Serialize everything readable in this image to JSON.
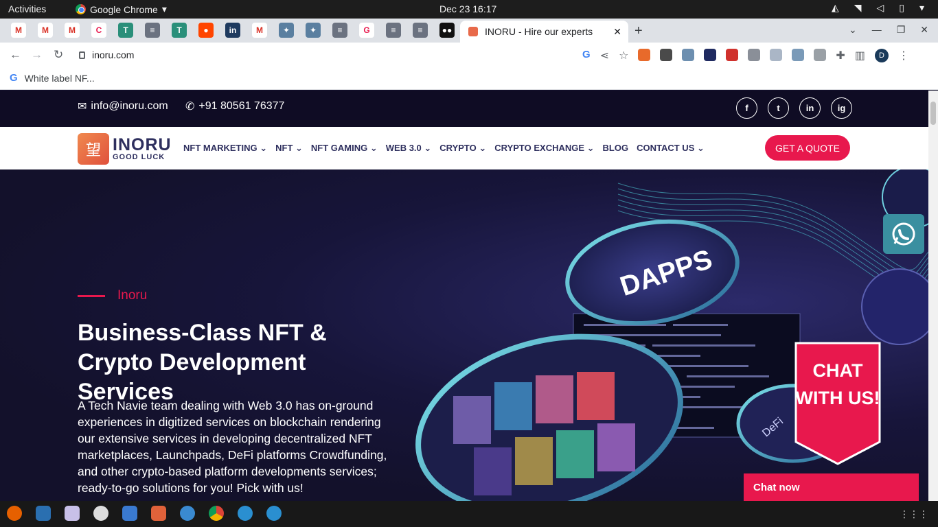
{
  "os_bar": {
    "activities": "Activities",
    "app_name": "Google Chrome",
    "clock": "Dec 23  16:17"
  },
  "browser": {
    "active_tab_title": "INORU - Hire our experts",
    "new_tab": "+",
    "url": "inoru.com",
    "bookmark": "White label NF..."
  },
  "site": {
    "email": "info@inoru.com",
    "phone": "+91 80561 76377",
    "social": [
      "f",
      "t",
      "in",
      "ig"
    ],
    "logo": {
      "name": "INORU",
      "tagline": "GOOD LUCK"
    },
    "menu": [
      "NFT MARKETING",
      "NFT",
      "NFT GAMING",
      "WEB 3.0",
      "CRYPTO",
      "CRYPTO EXCHANGE",
      "BLOG",
      "CONTACT US"
    ],
    "menu_dropdown": [
      true,
      true,
      true,
      true,
      true,
      true,
      false,
      true
    ],
    "cta": "GET A QUOTE",
    "hero": {
      "eyebrow": "Inoru",
      "title": "Business-Class NFT & Crypto Development Services",
      "description": "A Tech Navie team dealing with Web 3.0 has on-ground experiences in digitized services on blockchain rendering our extensive services in developing decentralized NFT marketplaces, Launchpads, DeFi platforms Crowdfunding, and other crypto-based platform developments services; ready-to-go solutions for you! Pick with us!"
    },
    "chat_badge": "CHAT WITH US!",
    "chat_now": "Chat now",
    "art_labels": {
      "dapps": "DAPPS",
      "defi": "DeFi"
    }
  },
  "colors": {
    "accent": "#e8184d",
    "navy": "#2e2f5e",
    "hero_bg": "#13112b",
    "whatsapp": "#3a8fa0"
  }
}
